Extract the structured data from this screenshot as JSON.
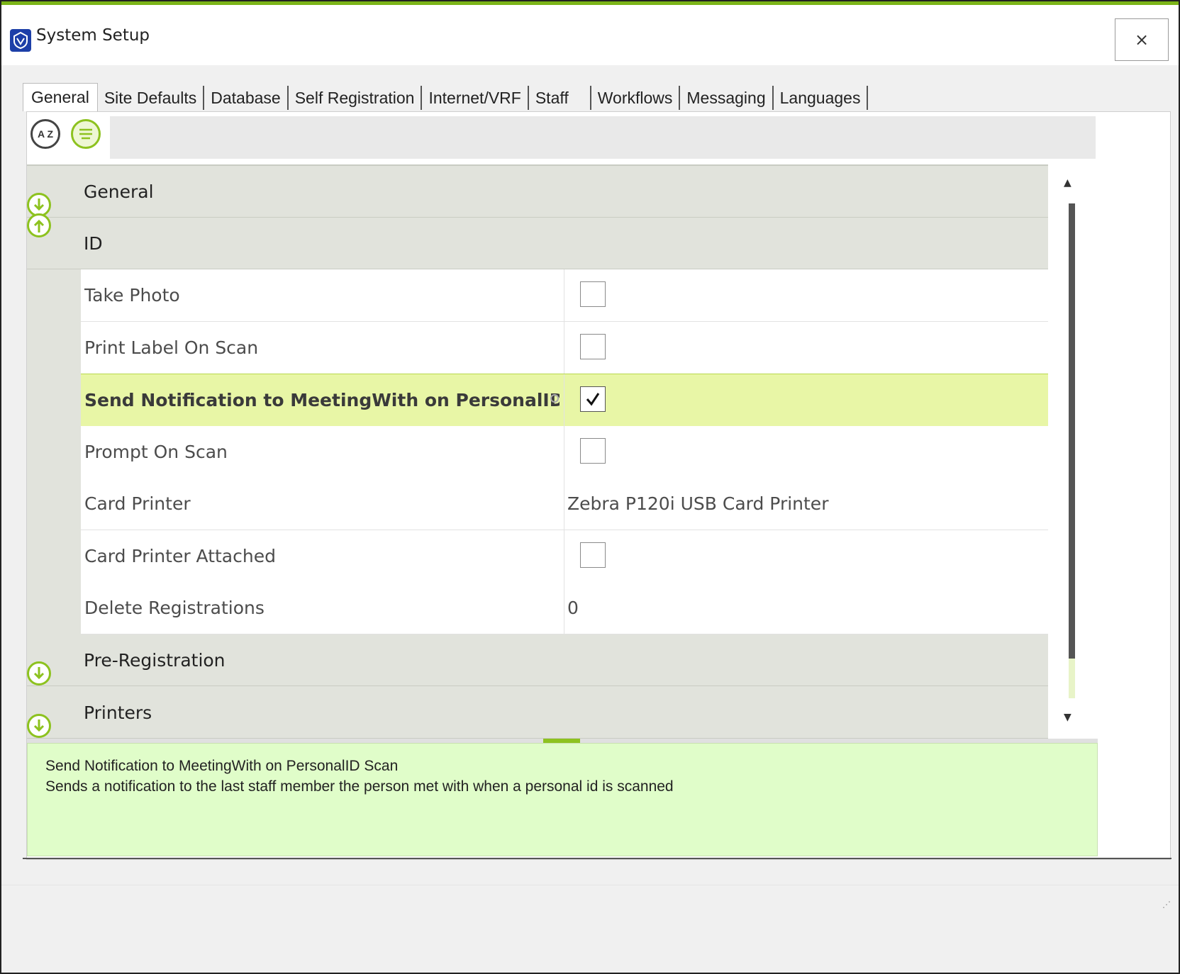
{
  "window": {
    "title": "System Setup",
    "close_label": "×",
    "accent_color": "#7cb518"
  },
  "tabs": [
    {
      "label": "General",
      "active": true
    },
    {
      "label": "Site Defaults"
    },
    {
      "label": "Database"
    },
    {
      "label": "Self Registration"
    },
    {
      "label": "Internet/VRF"
    },
    {
      "label": "Staff"
    },
    {
      "label": "Workflows"
    },
    {
      "label": "Messaging"
    },
    {
      "label": "Languages"
    }
  ],
  "toolbar": {
    "sort_label": "A Z",
    "search_value": ""
  },
  "grid": {
    "categories": {
      "general": {
        "label": "General",
        "state": "collapsed"
      },
      "id": {
        "label": "ID",
        "state": "expanded"
      },
      "pre_registration": {
        "label": "Pre-Registration",
        "state": "collapsed"
      },
      "printers": {
        "label": "Printers",
        "state": "collapsed"
      }
    },
    "properties": [
      {
        "name": "Take Photo",
        "type": "checkbox",
        "checked": false
      },
      {
        "name": "Print Label On Scan",
        "type": "checkbox",
        "checked": false
      },
      {
        "name": "Send Notification to MeetingWith on PersonalID S...",
        "type": "checkbox",
        "checked": true,
        "selected": true
      },
      {
        "name": "Prompt On Scan",
        "type": "checkbox",
        "checked": false
      },
      {
        "name": "Card Printer",
        "type": "text",
        "value": "Zebra P120i USB Card Printer"
      },
      {
        "name": "Card Printer Attached",
        "type": "checkbox",
        "checked": false
      },
      {
        "name": "Delete Registrations",
        "type": "text",
        "value": "0"
      }
    ],
    "checkmark": "✓"
  },
  "help": {
    "title": "Send Notification to MeetingWith on PersonalID Scan",
    "description": "Sends a notification to the last staff member the person met with when a personal id is scanned"
  }
}
